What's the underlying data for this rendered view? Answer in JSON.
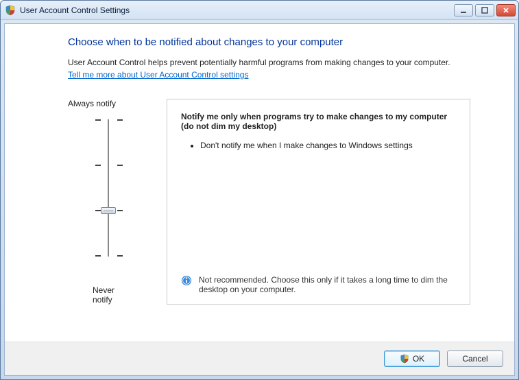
{
  "window": {
    "title": "User Account Control Settings"
  },
  "heading": "Choose when to be notified about changes to your computer",
  "description": "User Account Control helps prevent potentially harmful programs from making changes to your computer.",
  "help_link": "Tell me more about User Account Control settings",
  "slider": {
    "top_label": "Always notify",
    "bottom_label": "Never notify",
    "levels": 4,
    "current_level": 1
  },
  "panel": {
    "title": "Notify me only when programs try to make changes to my computer (do not dim my desktop)",
    "bullets": [
      "Don't notify me when I make changes to Windows settings"
    ],
    "note_icon": "info-icon",
    "note": "Not recommended. Choose this only if it takes a long time to dim the desktop on your computer."
  },
  "buttons": {
    "ok": "OK",
    "cancel": "Cancel"
  }
}
